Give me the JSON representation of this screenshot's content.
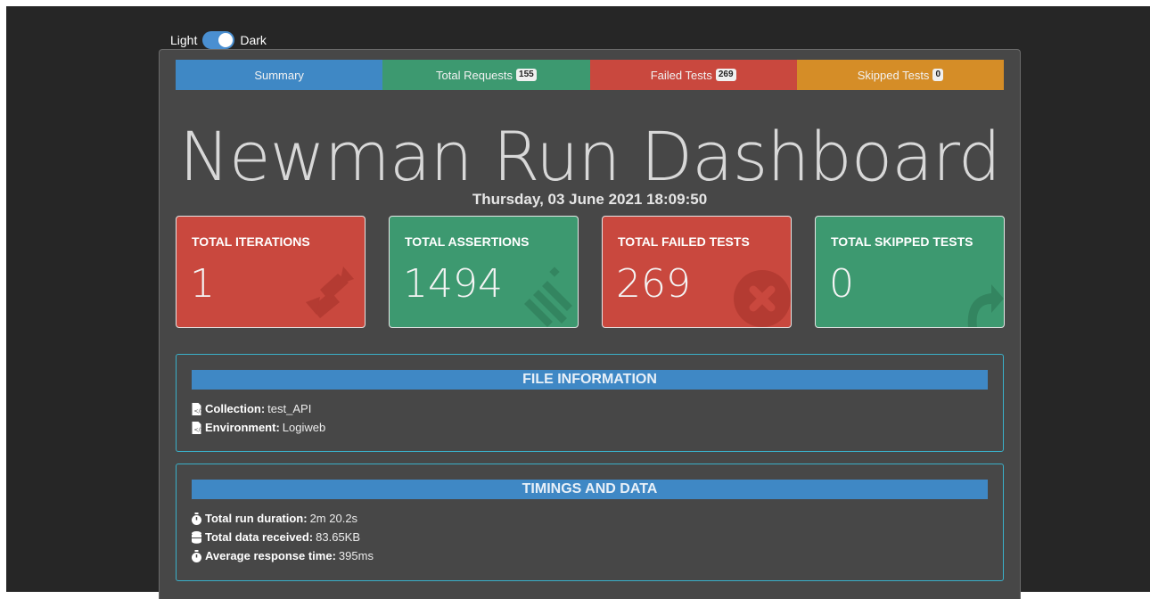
{
  "theme_toggle": {
    "light_label": "Light",
    "dark_label": "Dark",
    "state": "dark"
  },
  "tabs": [
    {
      "label": "Summary",
      "badge": null
    },
    {
      "label": "Total Requests",
      "badge": "155"
    },
    {
      "label": "Failed Tests",
      "badge": "269"
    },
    {
      "label": "Skipped Tests",
      "badge": "0"
    }
  ],
  "title": "Newman Run Dashboard",
  "date": "Thursday, 03 June 2021 18:09:50",
  "cards": [
    {
      "label": "TOTAL ITERATIONS",
      "value": "1",
      "icon": "sync-icon",
      "color": "#c9483e"
    },
    {
      "label": "TOTAL ASSERTIONS",
      "value": "1494",
      "icon": "list-check-icon",
      "color": "#3d9970"
    },
    {
      "label": "TOTAL FAILED TESTS",
      "value": "269",
      "icon": "times-circle-icon",
      "color": "#c9483e"
    },
    {
      "label": "TOTAL SKIPPED TESTS",
      "value": "0",
      "icon": "share-arrow-icon",
      "color": "#3d9970"
    }
  ],
  "file_info": {
    "header": "FILE INFORMATION",
    "collection_label": "Collection:",
    "collection_value": "test_API",
    "environment_label": "Environment:",
    "environment_value": "Logiweb"
  },
  "timings": {
    "header": "TIMINGS AND DATA",
    "duration_label": "Total run duration:",
    "duration_value": "2m 20.2s",
    "data_label": "Total data received:",
    "data_value": "83.65KB",
    "avg_label": "Average response time:",
    "avg_value": "395ms"
  }
}
